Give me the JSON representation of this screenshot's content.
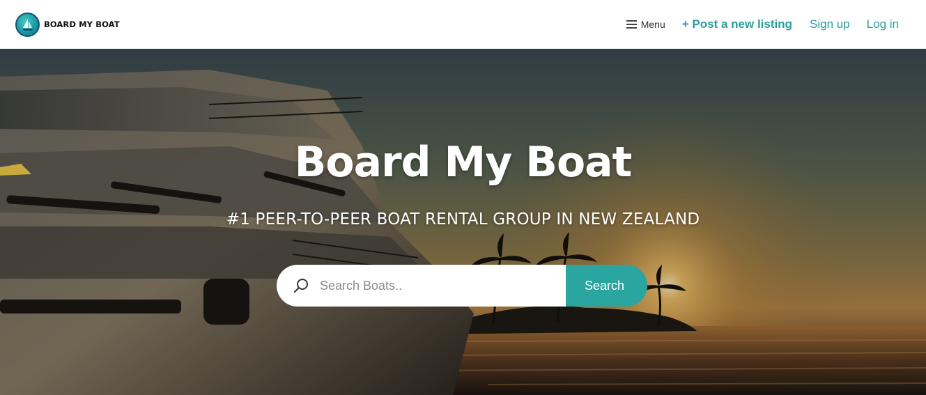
{
  "brand": {
    "name": "BOARD MY BOAT",
    "logo_icon": "sailboat-icon"
  },
  "nav": {
    "menu_label": "Menu",
    "menu_icon": "hamburger-icon",
    "post_listing": "+ Post a new listing",
    "sign_up": "Sign up",
    "log_in": "Log in"
  },
  "hero": {
    "title": "Board My Boat",
    "subtitle": "#1 PEER-TO-PEER BOAT RENTAL GROUP IN NEW ZEALAND",
    "search": {
      "placeholder": "Search Boats..",
      "icon": "search-icon",
      "button_label": "Search"
    }
  },
  "colors": {
    "accent": "#2aa5a0",
    "link": "#2a9d9a"
  }
}
